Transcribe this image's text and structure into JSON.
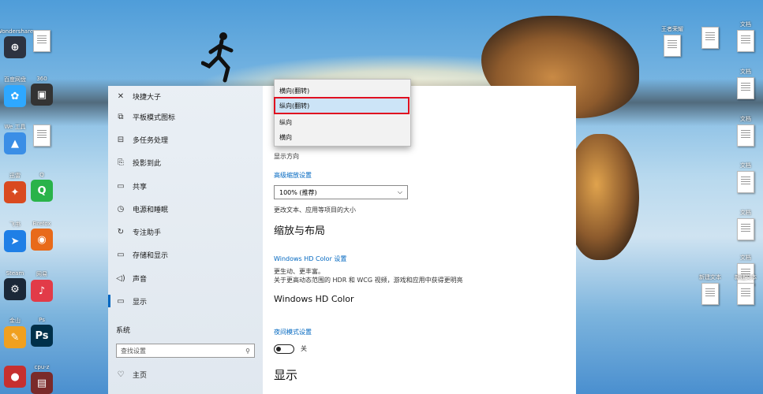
{
  "desktop": {
    "left_icons": [
      {
        "label": "Wondershare",
        "color": "#2d3340",
        "glyph": "⊕"
      },
      {
        "label": "",
        "kind": "doc"
      },
      {
        "label": "百度网盘",
        "color": "#2ea8ff",
        "glyph": "✿"
      },
      {
        "label": "360",
        "color": "#333",
        "glyph": "▣"
      },
      {
        "label": "We 工具",
        "color": "#3a8ee6",
        "glyph": "▲"
      },
      {
        "label": "",
        "kind": "doc"
      },
      {
        "label": "迅雷",
        "color": "#d94a20",
        "glyph": "✦"
      },
      {
        "label": "Q",
        "color": "#29b34a",
        "glyph": "Q"
      },
      {
        "label": "飞书",
        "color": "#1f7fe6",
        "glyph": "➤"
      },
      {
        "label": "Firefox",
        "color": "#e86a1a",
        "glyph": "◉"
      },
      {
        "label": "Steam",
        "color": "#1b2838",
        "glyph": "⚙"
      },
      {
        "label": "网易",
        "color": "#e23b48",
        "glyph": "♪"
      },
      {
        "label": "金山",
        "color": "#f0a020",
        "glyph": "✎"
      },
      {
        "label": "Ps",
        "color": "#00304a",
        "glyph": "Ps"
      },
      {
        "label": "",
        "color": "#c63030",
        "glyph": "●"
      },
      {
        "label": "cpu-z",
        "color": "#7a2a2a",
        "glyph": "▤"
      }
    ],
    "right_icons": [
      {
        "label": "王者荣耀"
      },
      {
        "label": ""
      },
      {
        "label": "文档"
      },
      {
        "label": "文档"
      },
      {
        "label": "文档"
      },
      {
        "label": "文档"
      },
      {
        "label": "文档"
      },
      {
        "label": "文档"
      },
      {
        "label": "新建文本"
      },
      {
        "label": "新建文本"
      }
    ]
  },
  "settings": {
    "nav_items": [
      {
        "icon": "✕",
        "label": "块捷大子"
      },
      {
        "icon": "⧉",
        "label": "平板模式图标"
      },
      {
        "icon": "⊟",
        "label": "多任务处理"
      },
      {
        "icon": "⎘",
        "label": "投影到此"
      },
      {
        "icon": "▭",
        "label": "共享"
      },
      {
        "icon": "◷",
        "label": "电源和睡眠"
      },
      {
        "icon": "↻",
        "label": "专注助手"
      },
      {
        "icon": "▭",
        "label": "存储和显示"
      },
      {
        "icon": "◁)",
        "label": "声音"
      },
      {
        "icon": "▭",
        "label": "显示"
      }
    ],
    "section_label": "系统",
    "search_placeholder": "查找设置",
    "search_icon": "⚲",
    "home_label": "主页",
    "home_icon": "♡",
    "content": {
      "title": "显示",
      "toggle_state": "关",
      "toggle_heading": "夜间模式设置",
      "hdr_heading": "Windows HD Color",
      "hdr_desc": "关于更高动态范围的 HDR 和 WCG 视频，游戏和应用中获得更明亮",
      "hdr_desc2": "更生动、更丰富。",
      "hdr_link": "Windows HD Color 设置",
      "scale_heading": "缩放与布局",
      "scale_desc": "更改文本、应用等项目的大小",
      "scale_value": "100% (推荐)",
      "scale_link": "高级缩放设置",
      "orientation_label": "显示方向"
    },
    "dropdown_options": [
      {
        "label": "横向(翻转)"
      },
      {
        "label": "纵向(翻转)",
        "selected": true
      },
      {
        "label": "纵向"
      },
      {
        "label": "横向"
      }
    ]
  }
}
